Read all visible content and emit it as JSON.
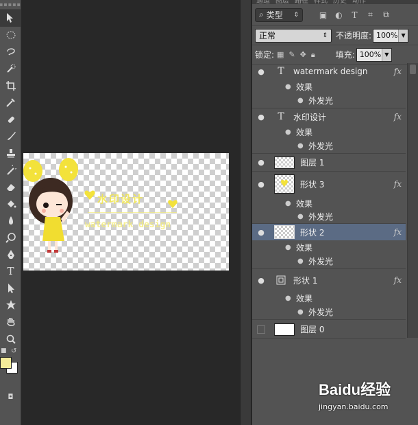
{
  "panel": {
    "tabs": [
      "通道",
      "图层",
      "路径",
      "样式",
      "历史",
      "动作"
    ],
    "filter": {
      "kind_label": "类型"
    },
    "blend": {
      "mode": "正常"
    },
    "opacity": {
      "label": "不透明度:",
      "value": "100%"
    },
    "lock": {
      "label": "锁定:"
    },
    "fill": {
      "label": "填充:",
      "value": "100%"
    }
  },
  "layers": [
    {
      "name": "watermark design",
      "type": "text",
      "thumb_glyph": "T",
      "fx": "fx",
      "effects_label": "效果",
      "effect": "外发光"
    },
    {
      "name": "水印设计",
      "type": "text",
      "thumb_glyph": "T",
      "fx": "fx",
      "effects_label": "效果",
      "effect": "外发光"
    },
    {
      "name": "图层 1",
      "type": "image"
    },
    {
      "name": "形状 3",
      "type": "shape-thumb",
      "fx": "fx",
      "effects_label": "效果",
      "effect": "外发光"
    },
    {
      "name": "形状 2",
      "type": "shape-thumb",
      "fx": "fx",
      "selected": true,
      "effects_label": "效果",
      "effect": "外发光"
    },
    {
      "name": "形状 1",
      "type": "shape",
      "fx": "fx",
      "effects_label": "效果",
      "effect": "外发光"
    },
    {
      "name": "图层 0",
      "type": "fill-white"
    }
  ],
  "canvas": {
    "watermark_cn": "水印设计",
    "watermark_en": "watermark design"
  },
  "colors": {
    "foreground": "#f4ec9a",
    "background": "#ffffff",
    "selection": "#5b6b84"
  },
  "watermark_site": {
    "logo": "Baidu经验",
    "url": "jingyan.baidu.com"
  }
}
